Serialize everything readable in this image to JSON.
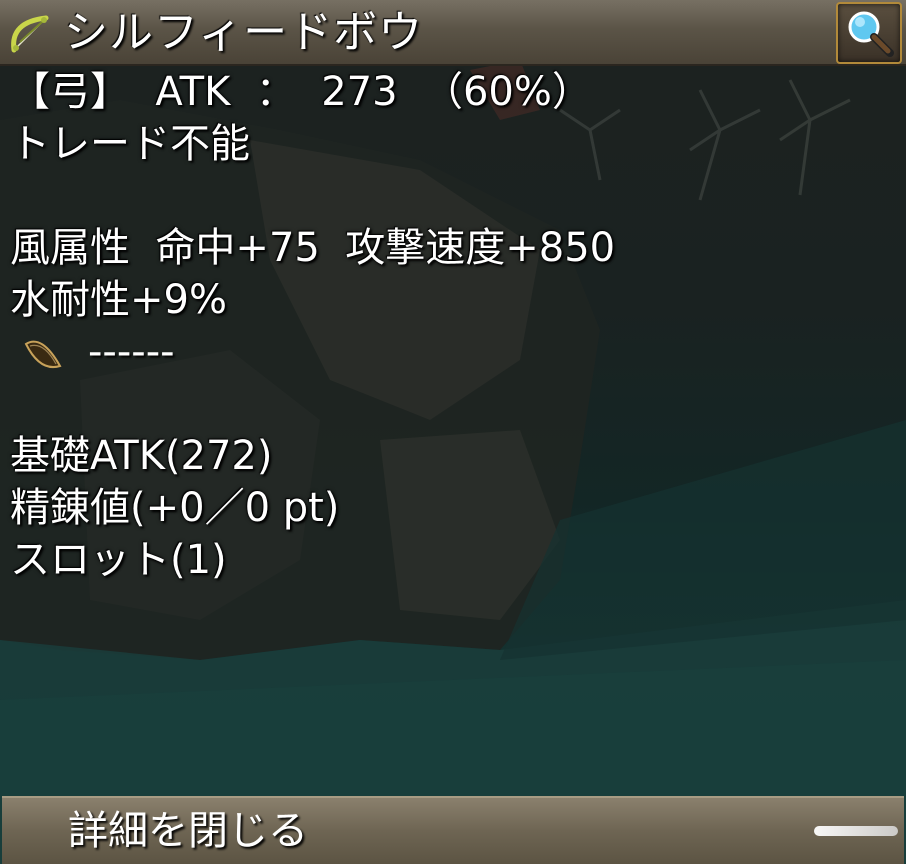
{
  "item": {
    "icon": "bow-icon",
    "name": "シルフィードボウ"
  },
  "toolbar": {
    "magnify_icon": "magnifier-icon"
  },
  "details": {
    "weapon_line": "【弓】  ATK  ：  273  （60%）",
    "trade_status": "トレード不能",
    "blank_1": "",
    "stats_line": "風属性  命中+75  攻撃速度+850",
    "resist_line": "水耐性+9%",
    "card_slot_icon": "card-slot-icon",
    "card_slot_text": "------",
    "blank_2": "",
    "base_atk": "基礎ATK(272)",
    "refine": "精錬値(+0／0 pt)",
    "slots": "スロット(1)"
  },
  "footer": {
    "close_label": "詳細を閉じる"
  },
  "colors": {
    "text": "#ffffff",
    "title_bar": "#5b5447",
    "footer_bar": "#6e6553",
    "button_border": "#b28a3a"
  }
}
